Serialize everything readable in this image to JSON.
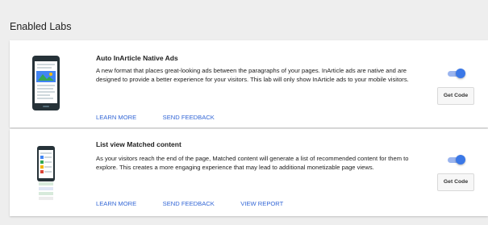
{
  "page": {
    "heading": "Enabled Labs"
  },
  "labs": [
    {
      "title": "Auto InArticle Native Ads",
      "description": "A new format that places great-looking ads between the paragraphs of your pages. InArticle ads are native and are designed to provide a better experience for your visitors. This lab will only show InArticle ads to your mobile visitors.",
      "links": [
        "LEARN MORE",
        "SEND FEEDBACK"
      ],
      "enabled": true,
      "button_label": "Get Code",
      "thumbnail_icon": "phone-inarticle-ad-icon"
    },
    {
      "title": "List view Matched content",
      "description": "As your visitors reach the end of the page, Matched content will generate a list of recommended content for them to explore. This creates a more engaging experience that may lead to additional monetizable page views.",
      "links": [
        "LEARN MORE",
        "SEND FEEDBACK",
        "VIEW REPORT"
      ],
      "enabled": true,
      "button_label": "Get Code",
      "thumbnail_icon": "phone-matched-content-icon"
    }
  ],
  "colors": {
    "link": "#3367d6",
    "toggle_on": "#3b78e7",
    "toggle_track": "#9ab4ee",
    "background": "#eeeeee",
    "card": "#ffffff"
  }
}
